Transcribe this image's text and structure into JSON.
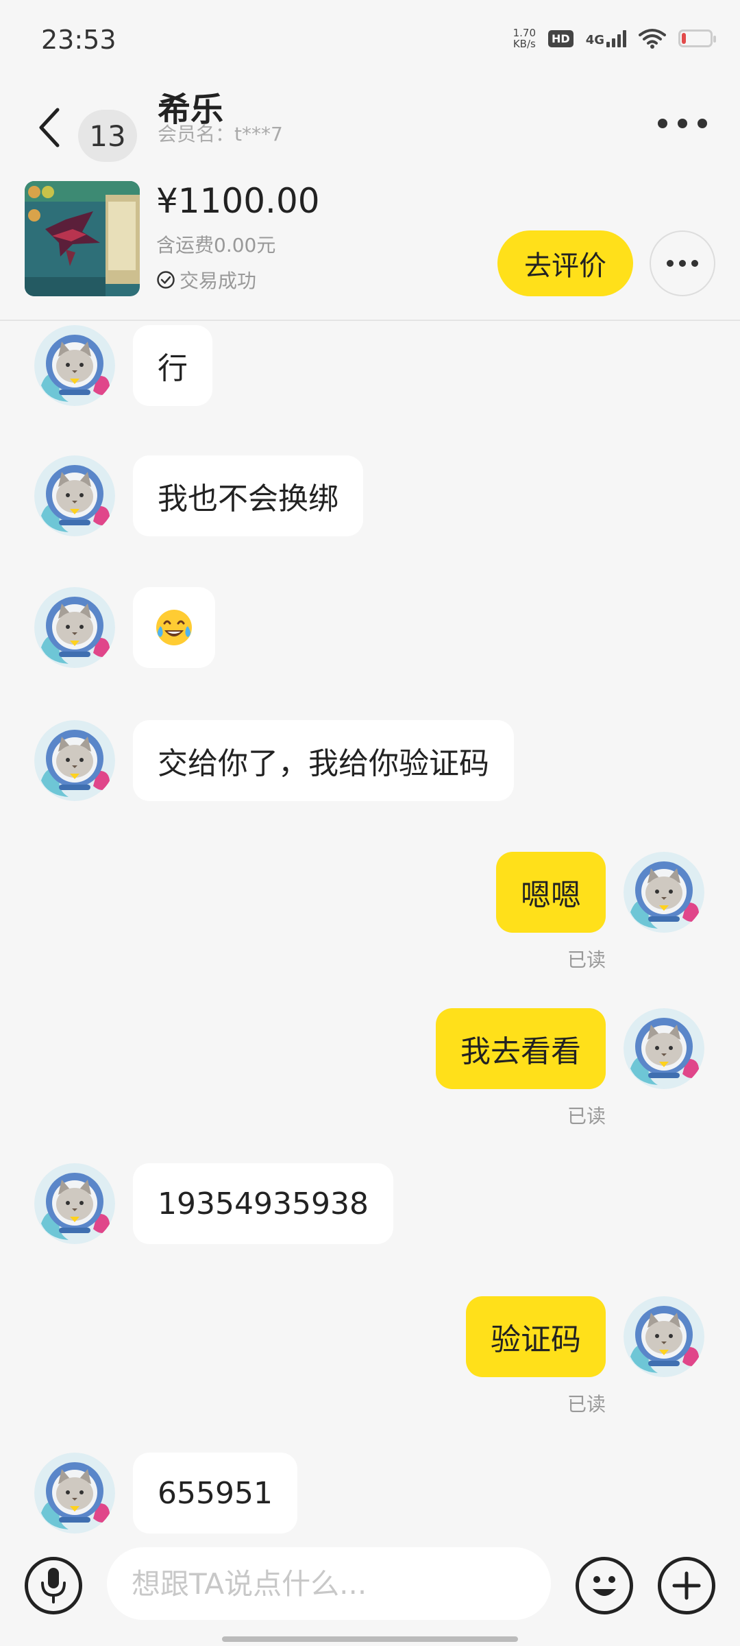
{
  "status": {
    "time": "23:53",
    "net_speed": "1.70",
    "net_unit": "KB/s",
    "hd": "HD",
    "network": "4G"
  },
  "header": {
    "back_icon": "chevron-left-icon",
    "unread": "13",
    "name": "希乐",
    "member": "会员名：t***7",
    "more_icon": "more-horizontal-icon"
  },
  "product": {
    "price": "¥1100.00",
    "shipping": "含运费0.00元",
    "status": "交易成功",
    "review_button": "去评价"
  },
  "messages": [
    {
      "from": "peer",
      "text": "行"
    },
    {
      "from": "peer",
      "text": "我也不会换绑"
    },
    {
      "from": "peer",
      "text": "😂"
    },
    {
      "from": "peer",
      "text": "交给你了，我给你验证码"
    },
    {
      "from": "me",
      "text": "嗯嗯",
      "read": "已读"
    },
    {
      "from": "me",
      "text": "我去看看",
      "read": "已读"
    },
    {
      "from": "peer",
      "text": "19354935938"
    },
    {
      "from": "me",
      "text": "验证码",
      "read": "已读"
    },
    {
      "from": "peer",
      "text": "655951"
    }
  ],
  "input": {
    "placeholder": "想跟TA说点什么..."
  },
  "colors": {
    "accent": "#ffe01a",
    "background": "#f6f6f6",
    "bubble_in": "#ffffff"
  }
}
